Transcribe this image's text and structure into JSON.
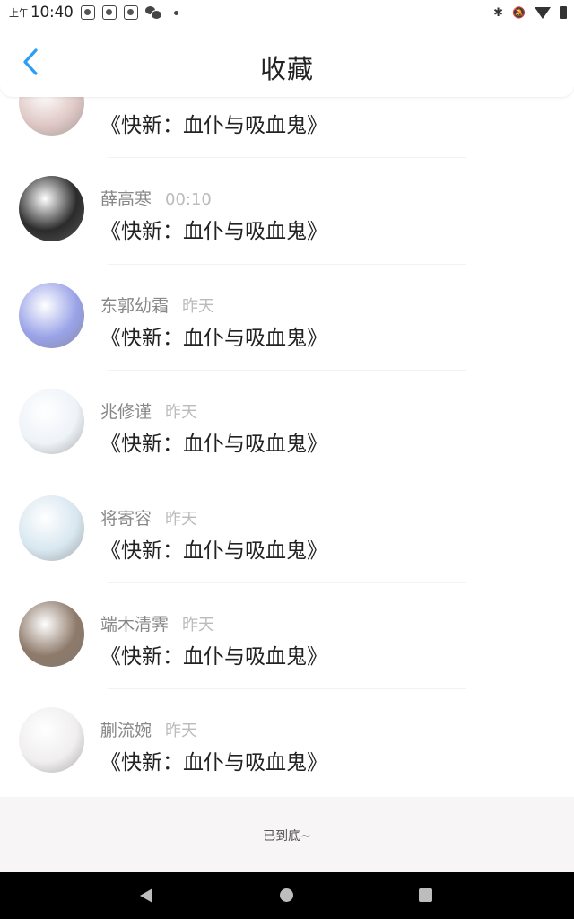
{
  "status_bar": {
    "ampm": "上午",
    "time": "10:40"
  },
  "header": {
    "title": "收藏"
  },
  "items": [
    {
      "author": "",
      "time": "",
      "title": "《快新：血仆与吸血鬼》",
      "avatar_color": "#e0c9c6"
    },
    {
      "author": "薛高寒",
      "time": "00:10",
      "title": "《快新：血仆与吸血鬼》",
      "avatar_color": "#2b2b2b"
    },
    {
      "author": "东郭幼霜",
      "time": "昨天",
      "title": "《快新：血仆与吸血鬼》",
      "avatar_color": "#9aa3e8"
    },
    {
      "author": "兆修谨",
      "time": "昨天",
      "title": "《快新：血仆与吸血鬼》",
      "avatar_color": "#eef3f8"
    },
    {
      "author": "将寄容",
      "time": "昨天",
      "title": "《快新：血仆与吸血鬼》",
      "avatar_color": "#d8e7f0"
    },
    {
      "author": "端木清霁",
      "time": "昨天",
      "title": "《快新：血仆与吸血鬼》",
      "avatar_color": "#8e7a6a"
    },
    {
      "author": "蒯流婉",
      "time": "昨天",
      "title": "《快新：血仆与吸血鬼》",
      "avatar_color": "#f0eeee"
    }
  ],
  "footer": {
    "end_text": "已到底~"
  },
  "colors": {
    "accent": "#2a9df4",
    "footer_bg": "#f7f5f5"
  }
}
